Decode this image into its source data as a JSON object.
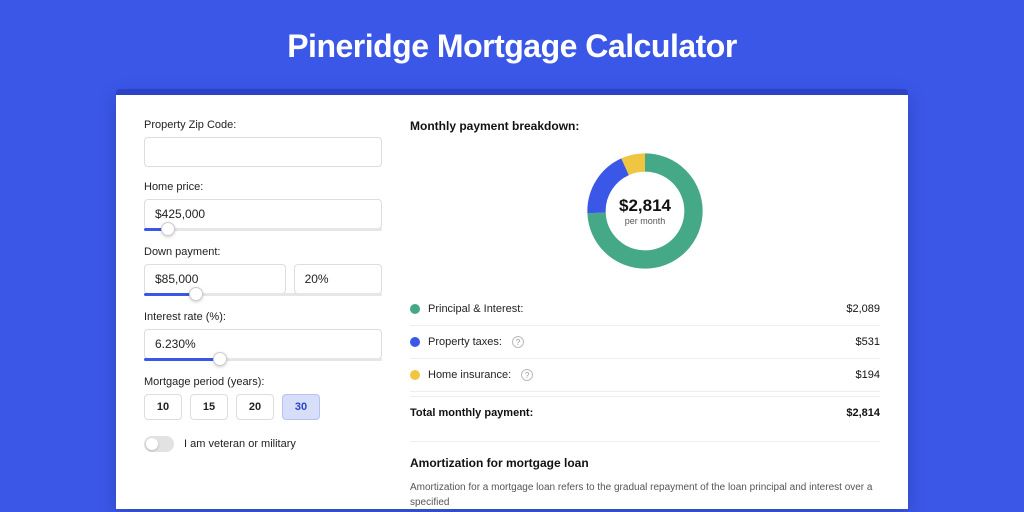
{
  "page": {
    "title": "Pineridge Mortgage Calculator"
  },
  "form": {
    "zip_label": "Property Zip Code:",
    "zip_value": "",
    "home_price_label": "Home price:",
    "home_price_value": "$425,000",
    "home_price_pct": 10,
    "down_payment_label": "Down payment:",
    "down_payment_value": "$85,000",
    "down_payment_pct_value": "20%",
    "down_payment_slider_pct": 22,
    "interest_label": "Interest rate (%):",
    "interest_value": "6.230%",
    "interest_slider_pct": 32,
    "period_label": "Mortgage period (years):",
    "periods": [
      "10",
      "15",
      "20",
      "30"
    ],
    "period_active_index": 3,
    "veteran_label": "I am veteran or military"
  },
  "breakdown": {
    "title": "Monthly payment breakdown:",
    "center_amount": "$2,814",
    "center_sub": "per month",
    "items": [
      {
        "label": "Principal & Interest:",
        "value": "$2,089",
        "color": "green",
        "help": false
      },
      {
        "label": "Property taxes:",
        "value": "$531",
        "color": "blue",
        "help": true
      },
      {
        "label": "Home insurance:",
        "value": "$194",
        "color": "yellow",
        "help": true
      }
    ],
    "total_label": "Total monthly payment:",
    "total_value": "$2,814"
  },
  "amortization": {
    "title": "Amortization for mortgage loan",
    "body": "Amortization for a mortgage loan refers to the gradual repayment of the loan principal and interest over a specified"
  },
  "colors": {
    "green": "#45a886",
    "blue": "#3a57e8",
    "yellow": "#f0c542"
  },
  "chart_data": {
    "type": "pie",
    "title": "Monthly payment breakdown",
    "categories": [
      "Principal & Interest",
      "Property taxes",
      "Home insurance"
    ],
    "values": [
      2089,
      531,
      194
    ],
    "total": 2814,
    "colors": [
      "#45a886",
      "#3a57e8",
      "#f0c542"
    ]
  }
}
